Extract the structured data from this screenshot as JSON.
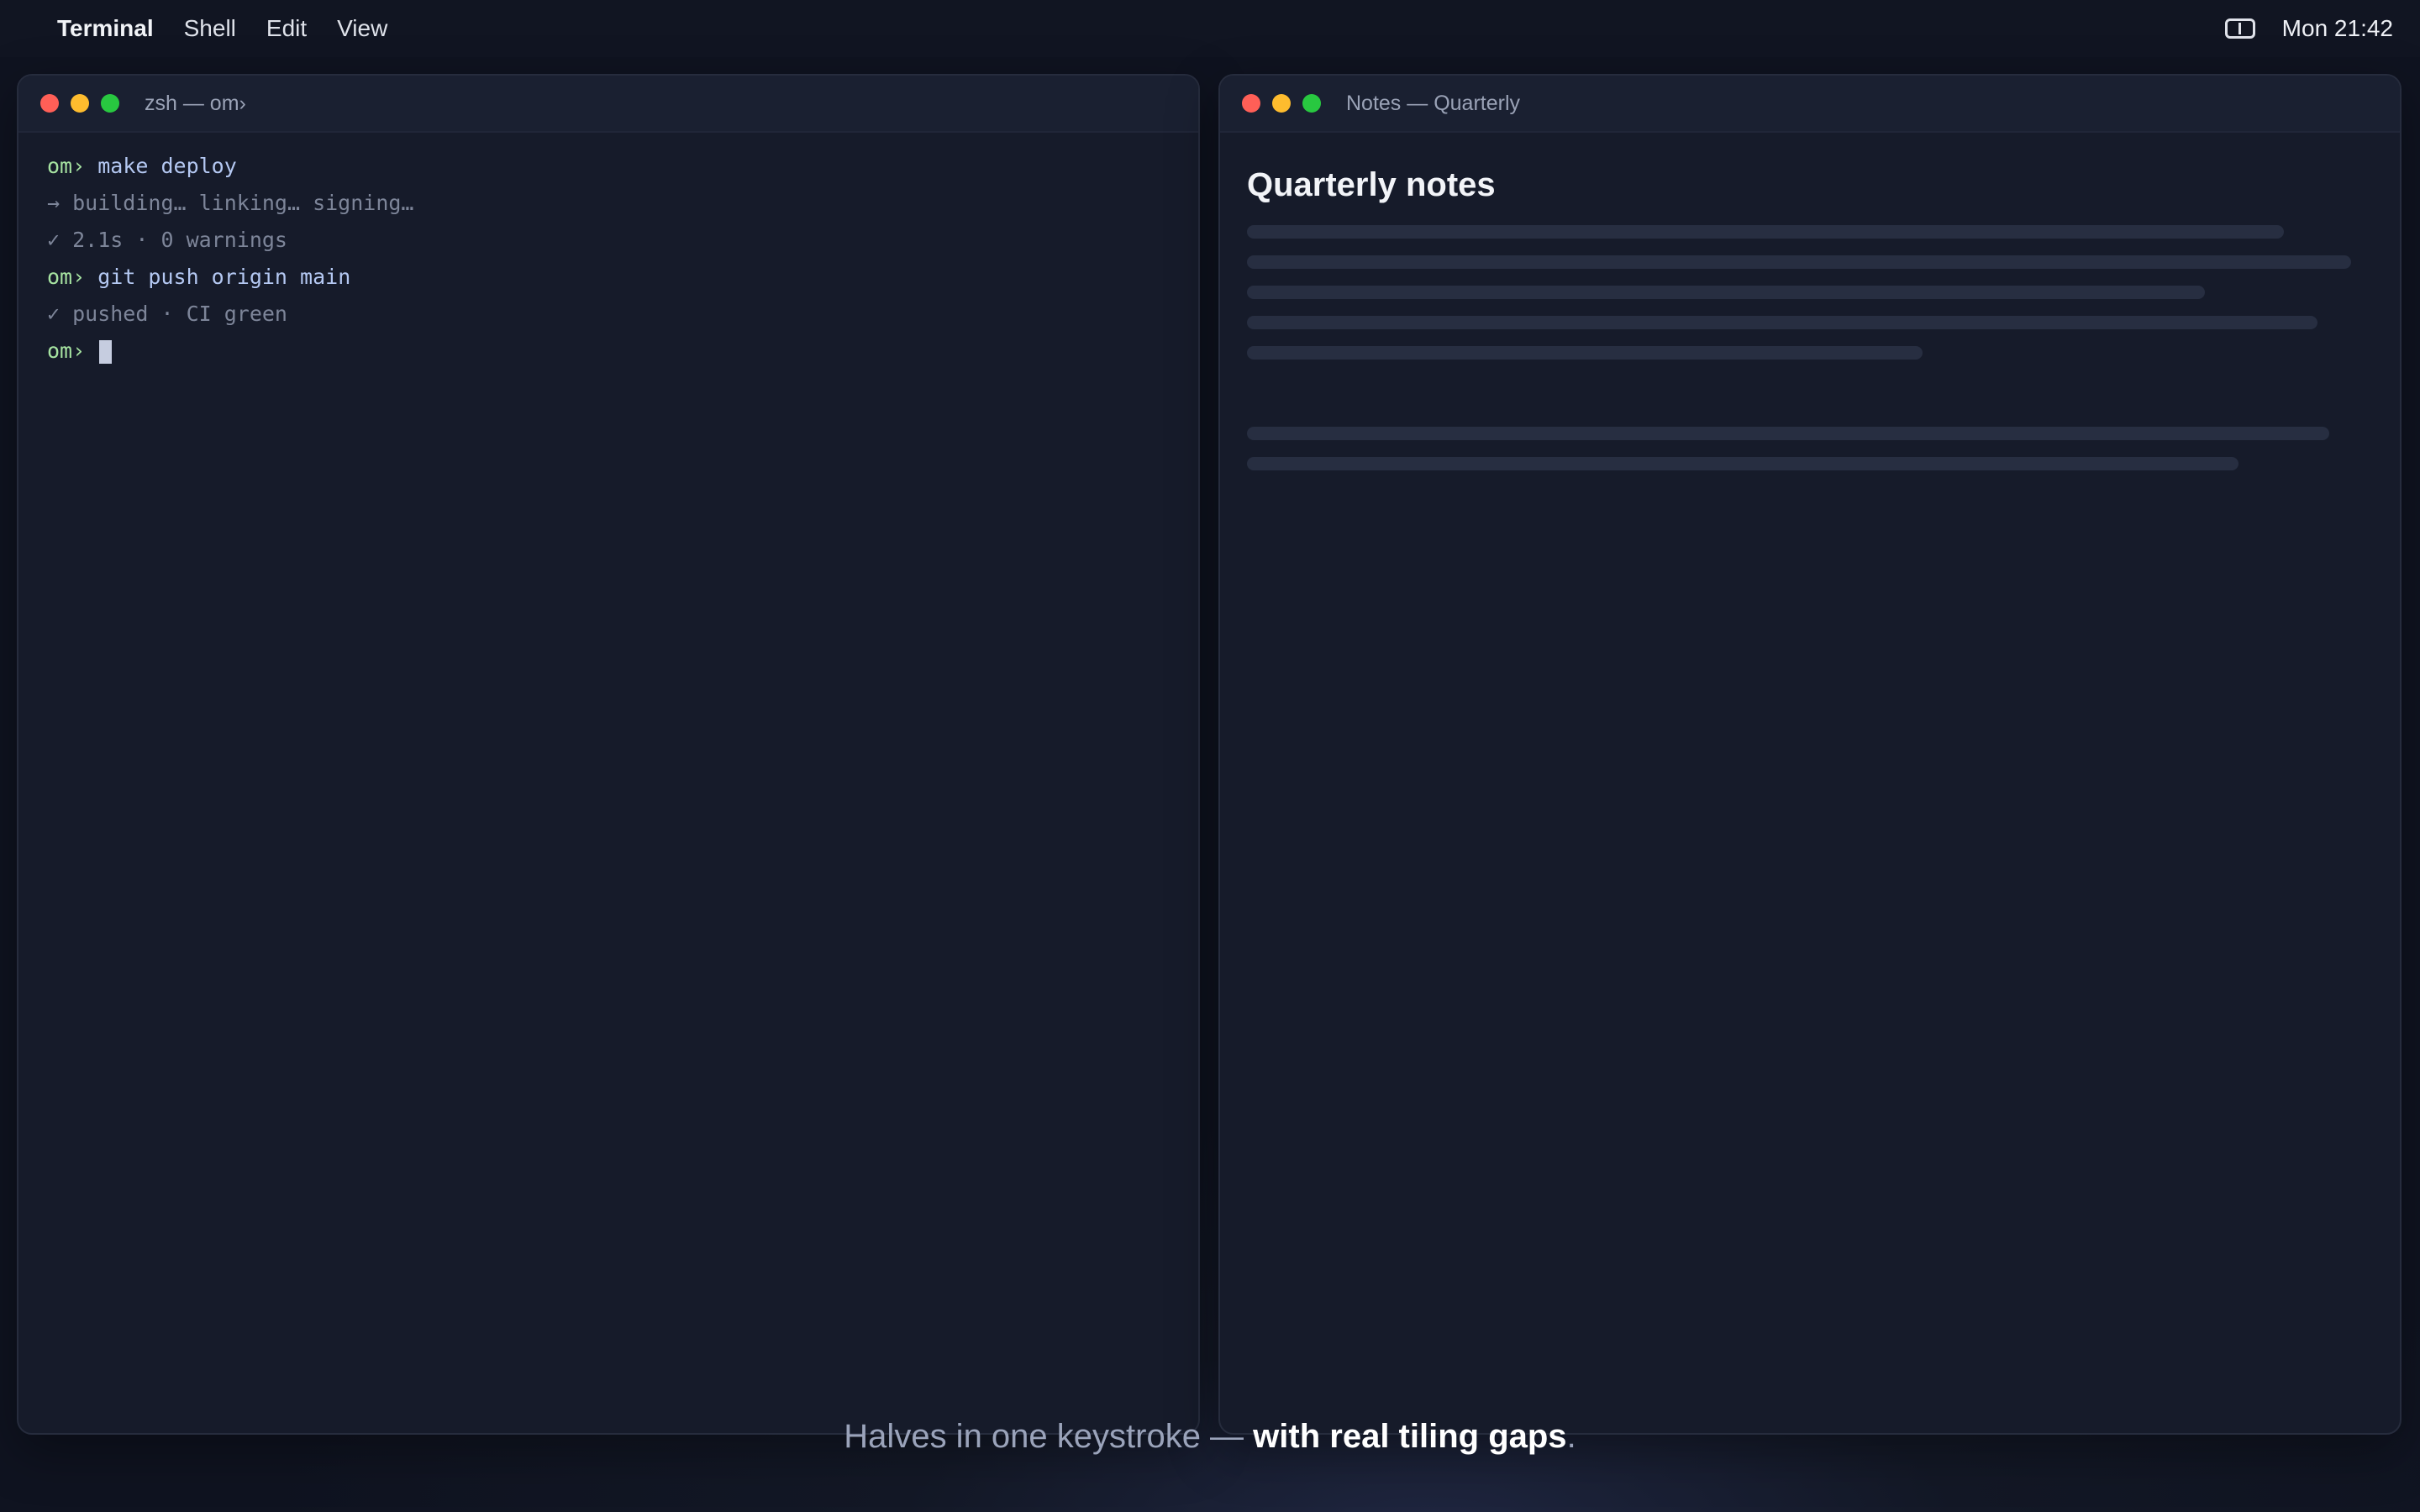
{
  "menubar": {
    "app_name": "Terminal",
    "items": [
      "Shell",
      "Edit",
      "View"
    ],
    "status_icon": "split-view-icon",
    "clock": "Mon 21:42"
  },
  "terminal_window": {
    "title": "zsh — om›",
    "lines": [
      {
        "prompt": "om›",
        "command": "make deploy"
      },
      {
        "output": "→ building… linking… signing…"
      },
      {
        "output": "✓ 2.1s · 0 warnings"
      },
      {
        "prompt": "om›",
        "command": "git push origin main"
      },
      {
        "output": "✓ pushed · CI green"
      },
      {
        "prompt": "om›",
        "command": ""
      }
    ]
  },
  "notes_window": {
    "title": "Notes — Quarterly",
    "heading": "Quarterly notes"
  },
  "caption": {
    "text": "Halves in one keystroke — ",
    "emphasis": "with real tiling gaps",
    "end": "."
  },
  "colors": {
    "close": "#ff5f57",
    "minimize": "#febc2e",
    "maximize": "#28c840",
    "prompt": "#a6e3a1",
    "command": "#b4c8f2"
  }
}
